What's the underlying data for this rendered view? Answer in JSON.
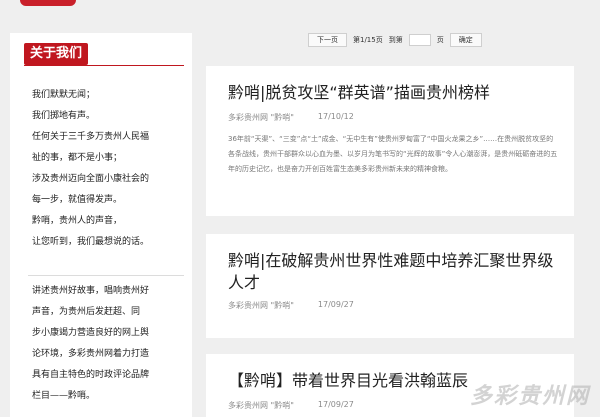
{
  "sidebar": {
    "title": "关于我们",
    "intro_lines": [
      "我们默默无闻；",
      "我们掷地有声。",
      "任何关于三千多万贵州人民福",
      "祉的事，都不是小事；",
      "涉及贵州迈向全面小康社会的",
      "每一步，就值得发声。",
      "黔哨，贵州人的声音，",
      "让您听到，我们最想说的话。"
    ],
    "mission_lines": [
      "讲述贵州好故事，唱响贵州好",
      "声音，为贵州后发赶超、同",
      "步小康竭力营造良好的网上舆",
      "论环境，多彩贵州网着力打造",
      "具有自主特色的时政评论品牌",
      "栏目——黔哨。"
    ]
  },
  "pager": {
    "prev": "下一页",
    "page_info": "第1/15页",
    "goto": "到第",
    "page_unit": "页",
    "confirm": "确定"
  },
  "articles": [
    {
      "title": "黔哨|脱贫攻坚“群英谱”描画贵州榜样",
      "source": "多彩贵州网 \"黔哨\"",
      "date": "17/10/12",
      "summary": "36年前“天渠”、“三变”点“土”成金、“无中生有”使贵州罗甸富了“中国火龙果之乡”……在贵州脱贫攻坚的各条战线，贵州干部群众以心血为墨、以岁月为笔书写的“光辉的故事”令人心潮澎湃，是贵州砥砺奋进的五年的历史记忆，也是奋力开创百姓富生态美多彩贵州新未来的精神食粮。"
    },
    {
      "title": "黔哨|在破解贵州世界性难题中培养汇聚世界级人才",
      "source": "多彩贵州网 \"黔哨\"",
      "date": "17/09/27",
      "summary": ""
    },
    {
      "title": "【黔哨】带着世界目光看洪翰蓝辰",
      "source": "多彩贵州网 \"黔哨\"",
      "date": "17/09/27",
      "summary": ""
    }
  ],
  "watermark": "多彩贵州网",
  "colors": {
    "accent": "#c0171f",
    "background": "#efefef"
  }
}
